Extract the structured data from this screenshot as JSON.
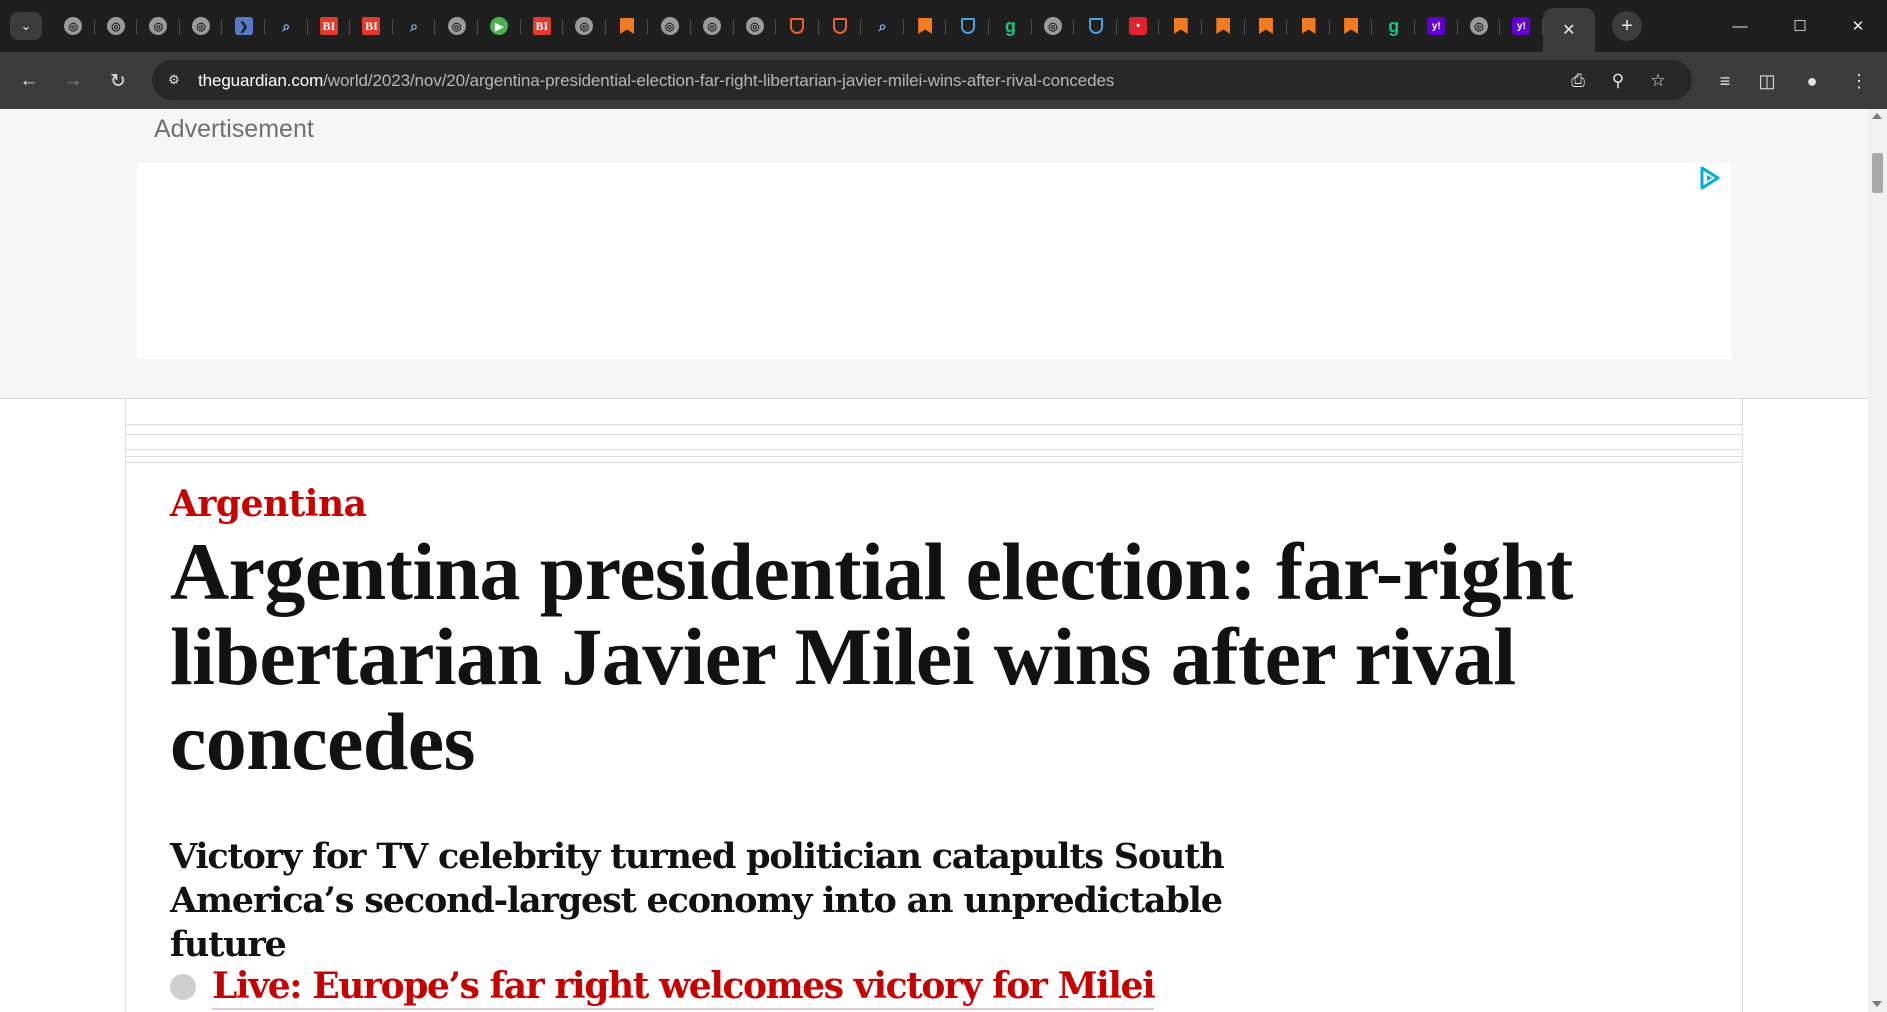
{
  "browser": {
    "tabs": [
      {
        "icon": "globe-icon"
      },
      {
        "icon": "globe-icon"
      },
      {
        "icon": "globe-icon"
      },
      {
        "icon": "globe-icon"
      },
      {
        "icon": "arrow-app-icon"
      },
      {
        "icon": "search-icon"
      },
      {
        "icon": "bi-icon",
        "text": "BI"
      },
      {
        "icon": "bi-icon",
        "text": "BI"
      },
      {
        "icon": "search-icon"
      },
      {
        "icon": "globe-icon"
      },
      {
        "icon": "play-icon"
      },
      {
        "icon": "bi-icon",
        "text": "BI"
      },
      {
        "icon": "globe-icon"
      },
      {
        "icon": "bookmark-icon"
      },
      {
        "icon": "globe-icon"
      },
      {
        "icon": "globe-icon"
      },
      {
        "icon": "globe-icon"
      },
      {
        "icon": "shield-icon"
      },
      {
        "icon": "shield-icon"
      },
      {
        "icon": "search-icon"
      },
      {
        "icon": "bookmark-icon"
      },
      {
        "icon": "shield-blue-icon"
      },
      {
        "icon": "g-icon",
        "text": "g"
      },
      {
        "icon": "globe-icon"
      },
      {
        "icon": "shield-blue-icon"
      },
      {
        "icon": "red-app-icon"
      },
      {
        "icon": "bookmark-icon"
      },
      {
        "icon": "bookmark-icon"
      },
      {
        "icon": "bookmark-icon"
      },
      {
        "icon": "bookmark-icon"
      },
      {
        "icon": "bookmark-icon"
      },
      {
        "icon": "g-icon",
        "text": "g"
      },
      {
        "icon": "yahoo-icon",
        "text": "y!"
      },
      {
        "icon": "globe-icon"
      },
      {
        "icon": "yahoo-icon",
        "text": "y!"
      }
    ],
    "url_host": "theguardian.com",
    "url_path": "/world/2023/nov/20/argentina-presidential-election-far-right-libertarian-javier-milei-wins-after-rival-concedes",
    "colors": {
      "tabstrip": "#1f1f1f",
      "toolbar": "#3c3c3c",
      "omnibox": "#282828"
    }
  },
  "page": {
    "ad_label": "Advertisement",
    "section": "Argentina",
    "headline": "Argentina presidential election: far-right libertarian Javier Milei wins after rival concedes",
    "standfirst": "Victory for TV celebrity turned politician catapults South America’s second-largest economy into an unpredictable future",
    "live_link": "Live: Europe’s far right welcomes victory for Milei",
    "colors": {
      "kicker": "#c70000",
      "text": "#121212",
      "ad_bg": "#f6f6f6"
    }
  }
}
